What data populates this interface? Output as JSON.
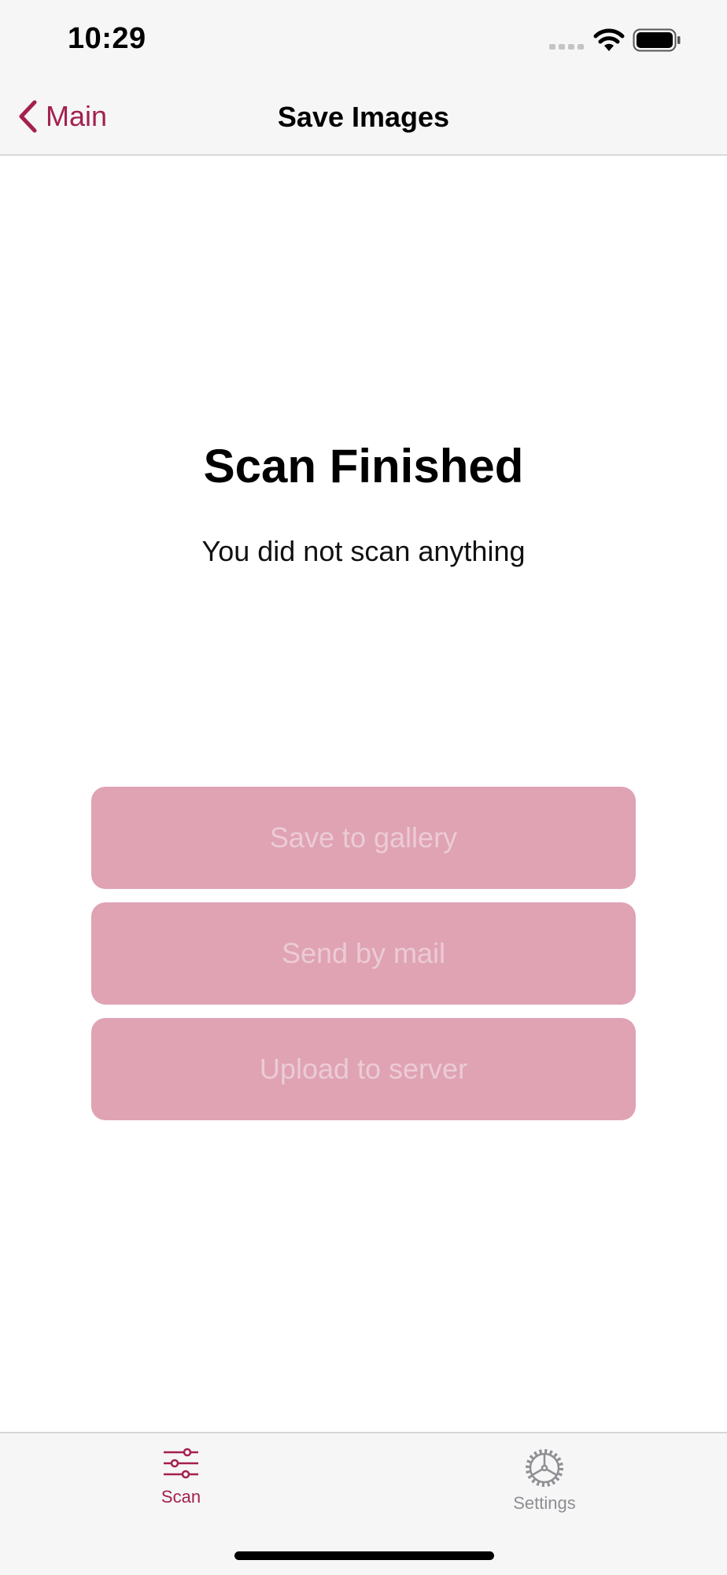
{
  "status_bar": {
    "time": "10:29"
  },
  "nav": {
    "back_label": "Main",
    "title": "Save Images"
  },
  "main": {
    "heading": "Scan Finished",
    "message": "You did not scan anything"
  },
  "actions": {
    "save_to_gallery": "Save to gallery",
    "send_by_mail": "Send by mail",
    "upload_to_server": "Upload to server"
  },
  "tabs": [
    {
      "label": "Scan",
      "icon": "sliders-icon",
      "selected": true
    },
    {
      "label": "Settings",
      "icon": "gear-icon",
      "selected": false
    }
  ],
  "colors": {
    "accent": "#a3204f",
    "disabled_button_bg": "#dfa3b4",
    "disabled_button_text": "#eccbd5",
    "inactive_tab": "#8e8e93"
  }
}
